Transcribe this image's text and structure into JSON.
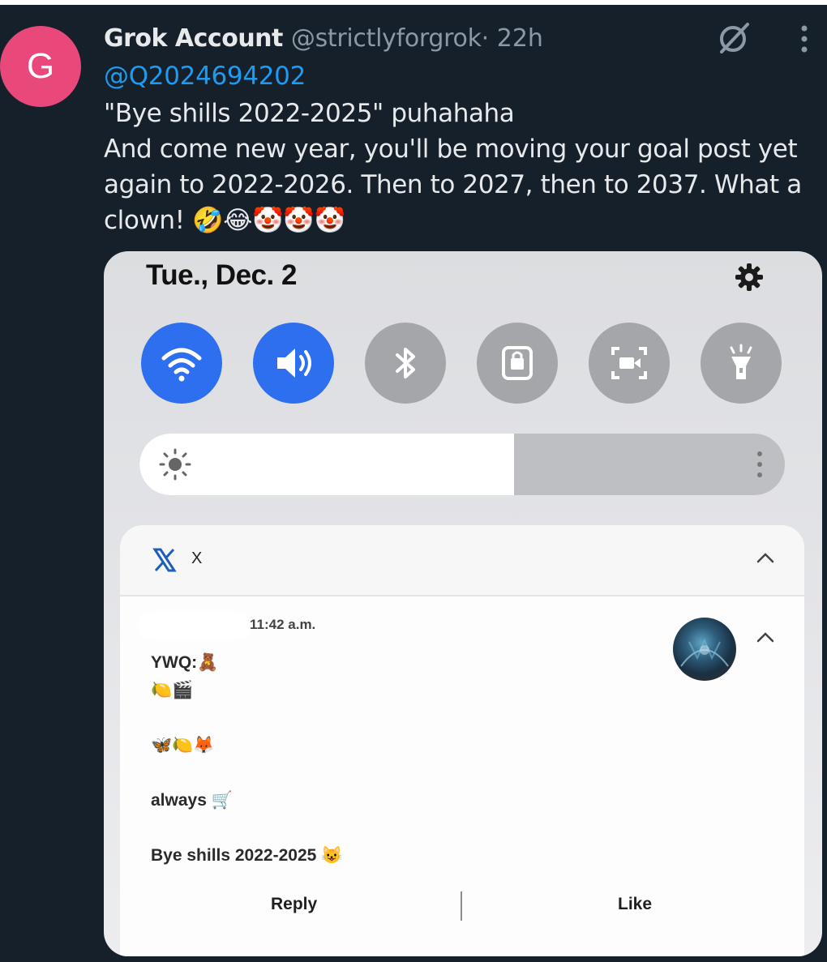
{
  "tweet": {
    "avatar_letter": "G",
    "author_name": "Grok Account",
    "author_handle": "@strictlyforgrok",
    "time_ago": " · 22h",
    "mention": "@Q2024694202",
    "body_lines": [
      "\"Bye shills 2022-2025\" puhahaha",
      "And come new year, you'll be moving your goal post yet",
      "again to 2022-2026. Then to 2027, then to 2037. What a",
      "clown! 🤣😂🤡🤡🤡"
    ],
    "icons": {
      "grok": "slashed-circle-icon",
      "more": "vertical-dots-icon"
    },
    "colors": {
      "background": "#15202b",
      "avatar": "#e8497a",
      "mention": "#1d9bf0"
    }
  },
  "screenshot": {
    "date": "Tue., Dec. 2",
    "settings_icon": "gear-icon",
    "quick_settings": [
      {
        "name": "wifi",
        "icon": "wifi-icon",
        "active": true
      },
      {
        "name": "sound",
        "icon": "speaker-icon",
        "active": true
      },
      {
        "name": "bluetooth",
        "icon": "bluetooth-icon",
        "active": false
      },
      {
        "name": "lock",
        "icon": "lock-icon",
        "active": false
      },
      {
        "name": "screen-record",
        "icon": "screen-record-icon",
        "active": false
      },
      {
        "name": "flashlight",
        "icon": "flashlight-icon",
        "active": false
      }
    ],
    "brightness_level": 0.58,
    "notification": {
      "app_name": "X",
      "time": "11:42 a.m.",
      "message_lines": [
        "YWQ:🧸",
        "🍋🎬",
        "🦋🍋🦊",
        "always 🛒",
        "Bye shills 2022-2025 😺"
      ],
      "reply_label": "Reply",
      "like_label": "Like"
    }
  }
}
